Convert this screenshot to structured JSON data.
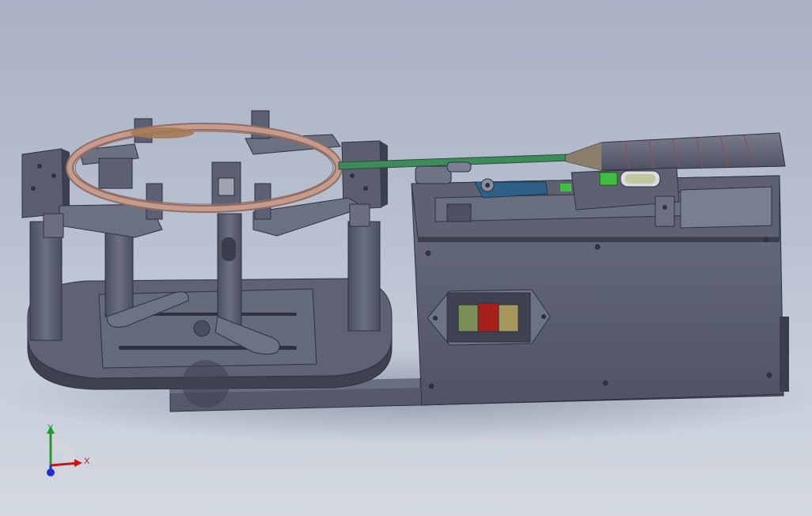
{
  "viewport": {
    "background_top": "#a9b1c4",
    "background_bottom": "#d3d8e2"
  },
  "model": {
    "components": [
      "base-plate",
      "frame-posts",
      "racket-clamp-arms",
      "racket-head-frame",
      "racket-shaft",
      "racket-handle-grip",
      "tension-head",
      "control-box",
      "switch-panel"
    ],
    "colors": {
      "body": "#5b5f70",
      "body_dark": "#3b3e4c",
      "body_light": "#7c8192",
      "racket_frame": "#c79a8e",
      "shaft": "#3e8a5a",
      "grip": "#5f6272",
      "bracket_blue": "#2e5f86",
      "switch_green": "#7d8d56",
      "switch_red": "#a7201c",
      "switch_yellow": "#a5985a",
      "level_green": "#3fbf3f"
    }
  },
  "triad": {
    "x_label": "X",
    "y_label": "Y",
    "x_color": "#c8151b",
    "y_color": "#1f9a2a",
    "z_color": "#1d2fc9"
  }
}
